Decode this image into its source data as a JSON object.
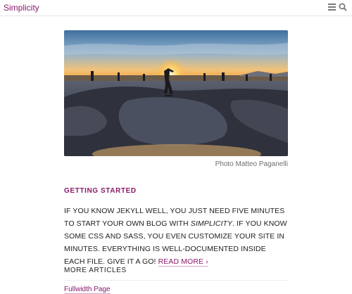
{
  "header": {
    "site_title": "Simplicity",
    "icons": [
      "menu-icon",
      "search-icon"
    ]
  },
  "hero": {
    "caption": "Photo Matteo Paganelli"
  },
  "post": {
    "title": "GETTING STARTED",
    "excerpt_part1": "IF YOU KNOW JEKYLL WELL, YOU JUST NEED FIVE MINUTES TO START YOUR OWN BLOG WITH ",
    "excerpt_em": "SIMPLICITY",
    "excerpt_part2": ". IF YOU KNOW SOME CSS AND SASS, YOU EVEN CUSTOMIZE YOUR SITE IN MINUTES. EVERYTHING IS WELL-DOCUMENTED INSIDE EACH FILE. GIVE IT A GO! ",
    "read_more": "READ MORE ›"
  },
  "more_articles": {
    "heading": "MORE ARTICLES",
    "items": [
      "Fullwidth Page"
    ]
  },
  "colors": {
    "accent": "#8a1a6b",
    "text": "#1d1d1d",
    "muted": "#6e6e6e"
  }
}
